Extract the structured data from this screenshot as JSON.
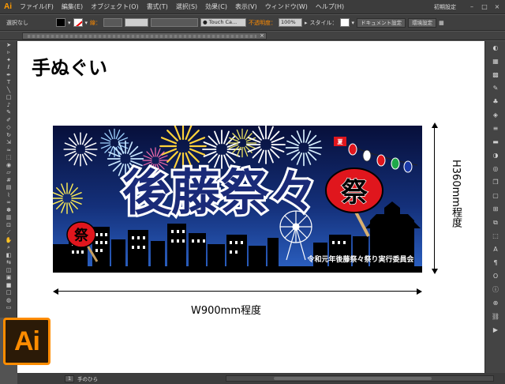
{
  "app": {
    "logo_small": "Ai",
    "logo_large": "Ai",
    "brand_color": "#ff8c00"
  },
  "menu": {
    "items": [
      "ファイル(F)",
      "編集(E)",
      "オブジェクト(O)",
      "書式(T)",
      "選択(S)",
      "効果(C)",
      "表示(V)",
      "ウィンドウ(W)",
      "ヘルプ(H)"
    ],
    "workspace": "初期設定"
  },
  "control_bar": {
    "selection": "選択なし",
    "stroke_label": "線：",
    "brush": "Touch Ca...",
    "opacity_label": "不透明度：",
    "opacity_value": "100%",
    "style_label": "スタイル：",
    "doc_settings": "ドキュメント設定",
    "preferences": "環境設定"
  },
  "status_bar": {
    "zoom": "手のひら",
    "page": "1"
  },
  "canvas": {
    "heading": "手ぬぐい",
    "banner": {
      "title": "後藤祭々",
      "badge_big": "祭",
      "badge_small": "祭",
      "tag": "夏",
      "footer": "令和元年後藤祭々祭り実行委員会",
      "colors": {
        "sky_top": "#0a1446",
        "sky_bottom": "#2a58b8",
        "red": "#e0161d",
        "title": "#1a2a78"
      }
    },
    "width_label": "W900mm程度",
    "height_label": "H360mm程度"
  },
  "tools": [
    "selection-icon",
    "direct-select-icon",
    "magic-wand-icon",
    "lasso-icon",
    "pen-icon",
    "type-icon",
    "line-icon",
    "rectangle-icon",
    "paintbrush-icon",
    "pencil-icon",
    "blob-brush-icon",
    "eraser-icon",
    "rotate-icon",
    "scale-icon",
    "width-icon",
    "free-transform-icon",
    "shape-builder-icon",
    "perspective-icon",
    "mesh-icon",
    "gradient-icon",
    "eyedropper-icon",
    "blend-icon",
    "symbol-sprayer-icon",
    "graph-icon",
    "artboard-icon",
    "slice-icon",
    "hand-icon",
    "zoom-icon",
    "fill-stroke-icon",
    "swap-icon",
    "draw-mode-icon",
    "screen-mode-icon",
    "drawing-modes-icon",
    "change-screen-icon",
    "fill-icon",
    "stroke-icon"
  ],
  "panels": [
    "color-icon",
    "color-guide-icon",
    "swatches-icon",
    "brushes-icon",
    "symbols-icon",
    "graphic-styles-icon",
    "stroke-panel-icon",
    "gradient-panel-icon",
    "transparency-icon",
    "appearance-icon",
    "layers-icon",
    "artboards-icon",
    "links-icon",
    "align-icon",
    "pathfinder-icon",
    "transform-icon",
    "character-icon",
    "paragraph-icon",
    "opentype-icon",
    "glyphs-icon",
    "type-ai-icon",
    "info-icon",
    "navigator-icon",
    "actions-icon"
  ]
}
